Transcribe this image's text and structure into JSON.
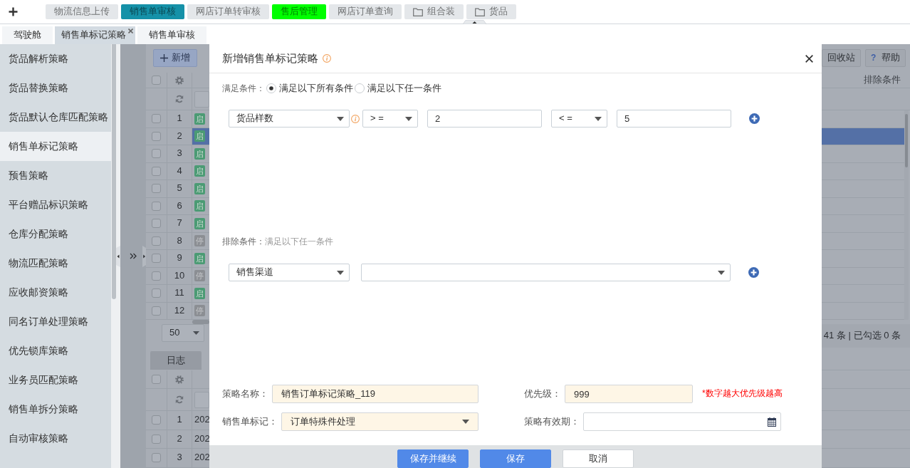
{
  "top_nav": {
    "tabs": [
      {
        "label": "物流信息上传",
        "kind": "page",
        "color": "#e4e7ea"
      },
      {
        "label": "销售单审核",
        "kind": "page",
        "color": "#1591a8"
      },
      {
        "label": "网店订单转审核",
        "kind": "page",
        "color": "#e4e7ea"
      },
      {
        "label": "售后管理",
        "kind": "page",
        "color": "#00ff00"
      },
      {
        "label": "网店订单查询",
        "kind": "page",
        "color": "#e4e7ea"
      },
      {
        "label": "组合装",
        "kind": "folder",
        "color": "#e4e7ea"
      },
      {
        "label": "货品",
        "kind": "folder",
        "color": "#e4e7ea"
      }
    ]
  },
  "page_tabs": [
    {
      "label": "驾驶舱",
      "selected": false
    },
    {
      "label": "销售单标记策略",
      "selected": true
    },
    {
      "label": "销售单审核",
      "selected": false
    }
  ],
  "sidebar": {
    "items": [
      {
        "label": "货品解析策略",
        "selected": false
      },
      {
        "label": "货品替换策略",
        "selected": false
      },
      {
        "label": "货品默认仓库匹配策略",
        "selected": false
      },
      {
        "label": "销售单标记策略",
        "selected": true
      },
      {
        "label": "预售策略",
        "selected": false
      },
      {
        "label": "平台赠品标识策略",
        "selected": false
      },
      {
        "label": "仓库分配策略",
        "selected": false
      },
      {
        "label": "物流匹配策略",
        "selected": false
      },
      {
        "label": "应收邮资策略",
        "selected": false
      },
      {
        "label": "同名订单处理策略",
        "selected": false
      },
      {
        "label": "优先锁库策略",
        "selected": false
      },
      {
        "label": "业务员匹配策略",
        "selected": false
      },
      {
        "label": "销售单拆分策略",
        "selected": false
      },
      {
        "label": "自动审核策略",
        "selected": false
      }
    ]
  },
  "strategy_list": {
    "new_button": "新增",
    "tool_buttons": [
      {
        "label": "回收站"
      },
      {
        "label": "帮助",
        "icon": "?"
      }
    ],
    "all_checked": false,
    "column_header": "排除条件",
    "rows": [
      {
        "number": "1",
        "status": "启",
        "enabled": true,
        "selected": false,
        "checked": false
      },
      {
        "number": "2",
        "status": "启",
        "enabled": true,
        "selected": true,
        "checked": false
      },
      {
        "number": "3",
        "status": "启",
        "enabled": true,
        "selected": false,
        "checked": false
      },
      {
        "number": "4",
        "status": "启",
        "enabled": true,
        "selected": false,
        "checked": false
      },
      {
        "number": "5",
        "status": "启",
        "enabled": true,
        "selected": false,
        "checked": false
      },
      {
        "number": "6",
        "status": "启",
        "enabled": true,
        "selected": false,
        "checked": false
      },
      {
        "number": "7",
        "status": "启",
        "enabled": true,
        "selected": false,
        "checked": false
      },
      {
        "number": "8",
        "status": "停",
        "enabled": false,
        "selected": false,
        "checked": false
      },
      {
        "number": "9",
        "status": "启",
        "enabled": true,
        "selected": false,
        "checked": false
      },
      {
        "number": "10",
        "status": "停",
        "enabled": false,
        "selected": false,
        "checked": false
      },
      {
        "number": "11",
        "status": "启",
        "enabled": true,
        "selected": false,
        "checked": false
      },
      {
        "number": "12",
        "status": "停",
        "enabled": false,
        "selected": false,
        "checked": false
      }
    ],
    "page_size": "50",
    "summary": "41 条 | 已勾选 0 条"
  },
  "log_panel": {
    "tab": "日志",
    "all_checked": false,
    "rows": [
      {
        "number": "1",
        "time": "202",
        "checked": false
      },
      {
        "number": "2",
        "time": "202",
        "checked": false
      },
      {
        "number": "3",
        "time": "202",
        "checked": false
      }
    ]
  },
  "dialog": {
    "title": "新增销售单标记策略",
    "match": {
      "label": "满足条件：",
      "options": [
        {
          "label": "满足以下所有条件",
          "selected": true
        },
        {
          "label": "满足以下任一条件",
          "selected": false
        }
      ]
    },
    "conditions": [
      {
        "field": "货品样数",
        "operator_1": "> =",
        "value_1": "2",
        "operator_2": "< =",
        "value_2": "5"
      }
    ],
    "exclude": {
      "label": "排除条件：",
      "hint": "满足以下任一条件",
      "rows": [
        {
          "field": "销售渠道"
        }
      ]
    },
    "fields": [
      {
        "label": "策略名称：",
        "kind": "text",
        "required": true,
        "value": "销售订单标记策略_119"
      },
      {
        "label": "优先级：",
        "kind": "text",
        "required": true,
        "value": "999",
        "note": "*数字越大优先级越高"
      },
      {
        "label": "销售单标记：",
        "kind": "select",
        "required": true,
        "value": "订单特殊件处理"
      },
      {
        "label": "策略有效期：",
        "kind": "date",
        "required": false
      }
    ],
    "buttons": [
      {
        "label": "保存并继续",
        "kind": "primary"
      },
      {
        "label": "保存",
        "kind": "primary"
      },
      {
        "label": "取消",
        "kind": "default"
      }
    ]
  }
}
